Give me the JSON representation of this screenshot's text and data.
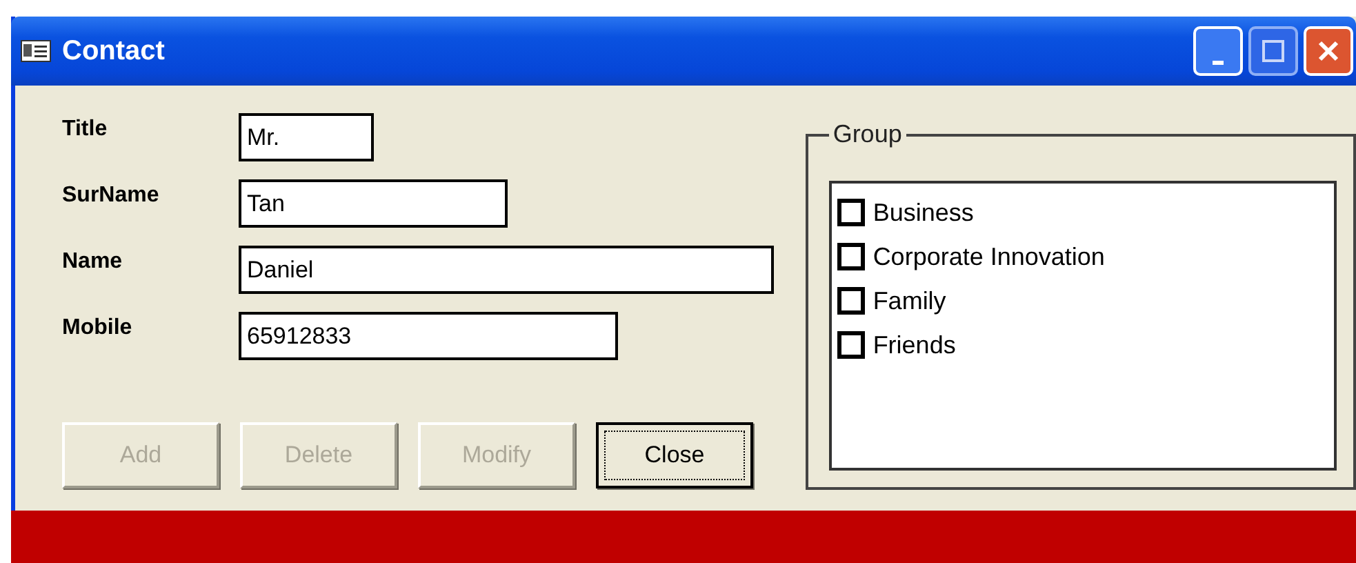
{
  "window": {
    "title": "Contact"
  },
  "fields": [
    {
      "label": "Title",
      "value": "Mr."
    },
    {
      "label": "SurName",
      "value": "Tan"
    },
    {
      "label": "Name",
      "value": "Daniel"
    },
    {
      "label": "Mobile",
      "value": "65912833"
    }
  ],
  "buttons": [
    {
      "label": "Add",
      "disabled": true,
      "focused": false
    },
    {
      "label": "Delete",
      "disabled": true,
      "focused": false
    },
    {
      "label": "Modify",
      "disabled": true,
      "focused": false
    },
    {
      "label": "Close",
      "disabled": false,
      "focused": true
    }
  ],
  "group": {
    "title": "Group",
    "items": [
      {
        "label": "Business",
        "checked": false
      },
      {
        "label": "Corporate Innovation",
        "checked": false
      },
      {
        "label": "Family",
        "checked": false
      },
      {
        "label": "Friends",
        "checked": false
      }
    ]
  }
}
